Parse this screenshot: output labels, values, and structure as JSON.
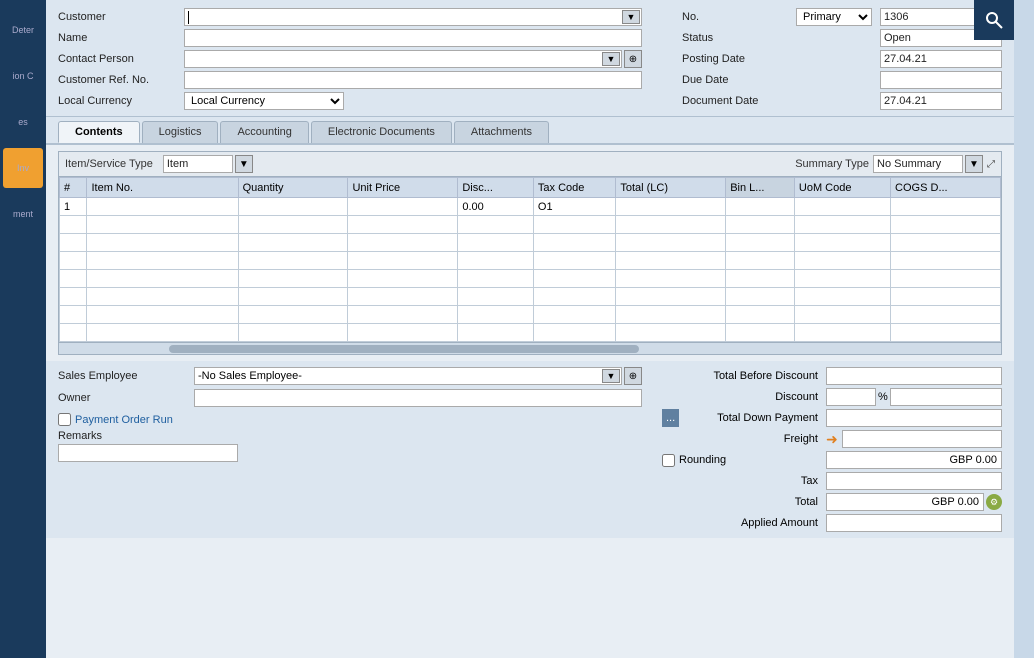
{
  "sidebar": {
    "items": [
      {
        "label": "Deter",
        "active": false
      },
      {
        "label": "ion C",
        "active": false
      },
      {
        "label": "es",
        "active": false
      },
      {
        "label": "Inv",
        "active": true
      },
      {
        "label": "ment",
        "active": false
      }
    ]
  },
  "header": {
    "customer_label": "Customer",
    "name_label": "Name",
    "contact_person_label": "Contact Person",
    "customer_ref_label": "Customer Ref. No.",
    "local_currency_label": "Local Currency",
    "local_currency_value": "Local Currency",
    "no_label": "No.",
    "primary_value": "Primary",
    "no_value": "1306",
    "status_label": "Status",
    "status_value": "Open",
    "posting_date_label": "Posting Date",
    "posting_date_value": "27.04.21",
    "due_date_label": "Due Date",
    "due_date_value": "",
    "document_date_label": "Document Date",
    "document_date_value": "27.04.21"
  },
  "tabs": [
    {
      "label": "Contents",
      "active": true
    },
    {
      "label": "Logistics",
      "active": false
    },
    {
      "label": "Accounting",
      "active": false
    },
    {
      "label": "Electronic Documents",
      "active": false
    },
    {
      "label": "Attachments",
      "active": false
    }
  ],
  "table": {
    "item_service_type_label": "Item/Service Type",
    "item_type_value": "Item",
    "summary_type_label": "Summary Type",
    "summary_type_value": "No Summary",
    "columns": [
      "#",
      "Item No.",
      "Quantity",
      "Unit Price",
      "Disc...",
      "Tax Code",
      "Total (LC)",
      "Bin L...",
      "UoM Code",
      "COGS D..."
    ],
    "rows": [
      {
        "num": "1",
        "item_no": "",
        "quantity": "",
        "unit_price": "",
        "disc": "0.00",
        "tax_code": "O1",
        "total_lc": "",
        "bin_l": "",
        "uom_code": "",
        "cogs_d": ""
      },
      {
        "num": "",
        "item_no": "",
        "quantity": "",
        "unit_price": "",
        "disc": "",
        "tax_code": "",
        "total_lc": "",
        "bin_l": "",
        "uom_code": "",
        "cogs_d": ""
      },
      {
        "num": "",
        "item_no": "",
        "quantity": "",
        "unit_price": "",
        "disc": "",
        "tax_code": "",
        "total_lc": "",
        "bin_l": "",
        "uom_code": "",
        "cogs_d": ""
      },
      {
        "num": "",
        "item_no": "",
        "quantity": "",
        "unit_price": "",
        "disc": "",
        "tax_code": "",
        "total_lc": "",
        "bin_l": "",
        "uom_code": "",
        "cogs_d": ""
      },
      {
        "num": "",
        "item_no": "",
        "quantity": "",
        "unit_price": "",
        "disc": "",
        "tax_code": "",
        "total_lc": "",
        "bin_l": "",
        "uom_code": "",
        "cogs_d": ""
      },
      {
        "num": "",
        "item_no": "",
        "quantity": "",
        "unit_price": "",
        "disc": "",
        "tax_code": "",
        "total_lc": "",
        "bin_l": "",
        "uom_code": "",
        "cogs_d": ""
      },
      {
        "num": "",
        "item_no": "",
        "quantity": "",
        "unit_price": "",
        "disc": "",
        "tax_code": "",
        "total_lc": "",
        "bin_l": "",
        "uom_code": "",
        "cogs_d": ""
      },
      {
        "num": "",
        "item_no": "",
        "quantity": "",
        "unit_price": "",
        "disc": "",
        "tax_code": "",
        "total_lc": "",
        "bin_l": "",
        "uom_code": "",
        "cogs_d": ""
      }
    ]
  },
  "bottom": {
    "sales_employee_label": "Sales Employee",
    "sales_employee_value": "-No Sales Employee-",
    "owner_label": "Owner",
    "owner_value": "",
    "payment_order_label": "Payment Order Run",
    "remarks_label": "Remarks",
    "total_before_discount_label": "Total Before Discount",
    "total_before_discount_value": "",
    "discount_label": "Discount",
    "discount_value": "",
    "percent_symbol": "%",
    "total_down_payment_label": "Total Down Payment",
    "total_down_payment_value": "",
    "freight_label": "Freight",
    "rounding_label": "Rounding",
    "rounding_value": "GBP 0.00",
    "tax_label": "Tax",
    "tax_value": "",
    "total_label": "Total",
    "total_value": "GBP 0.00",
    "applied_amount_label": "Applied Amount",
    "applied_amount_value": ""
  }
}
